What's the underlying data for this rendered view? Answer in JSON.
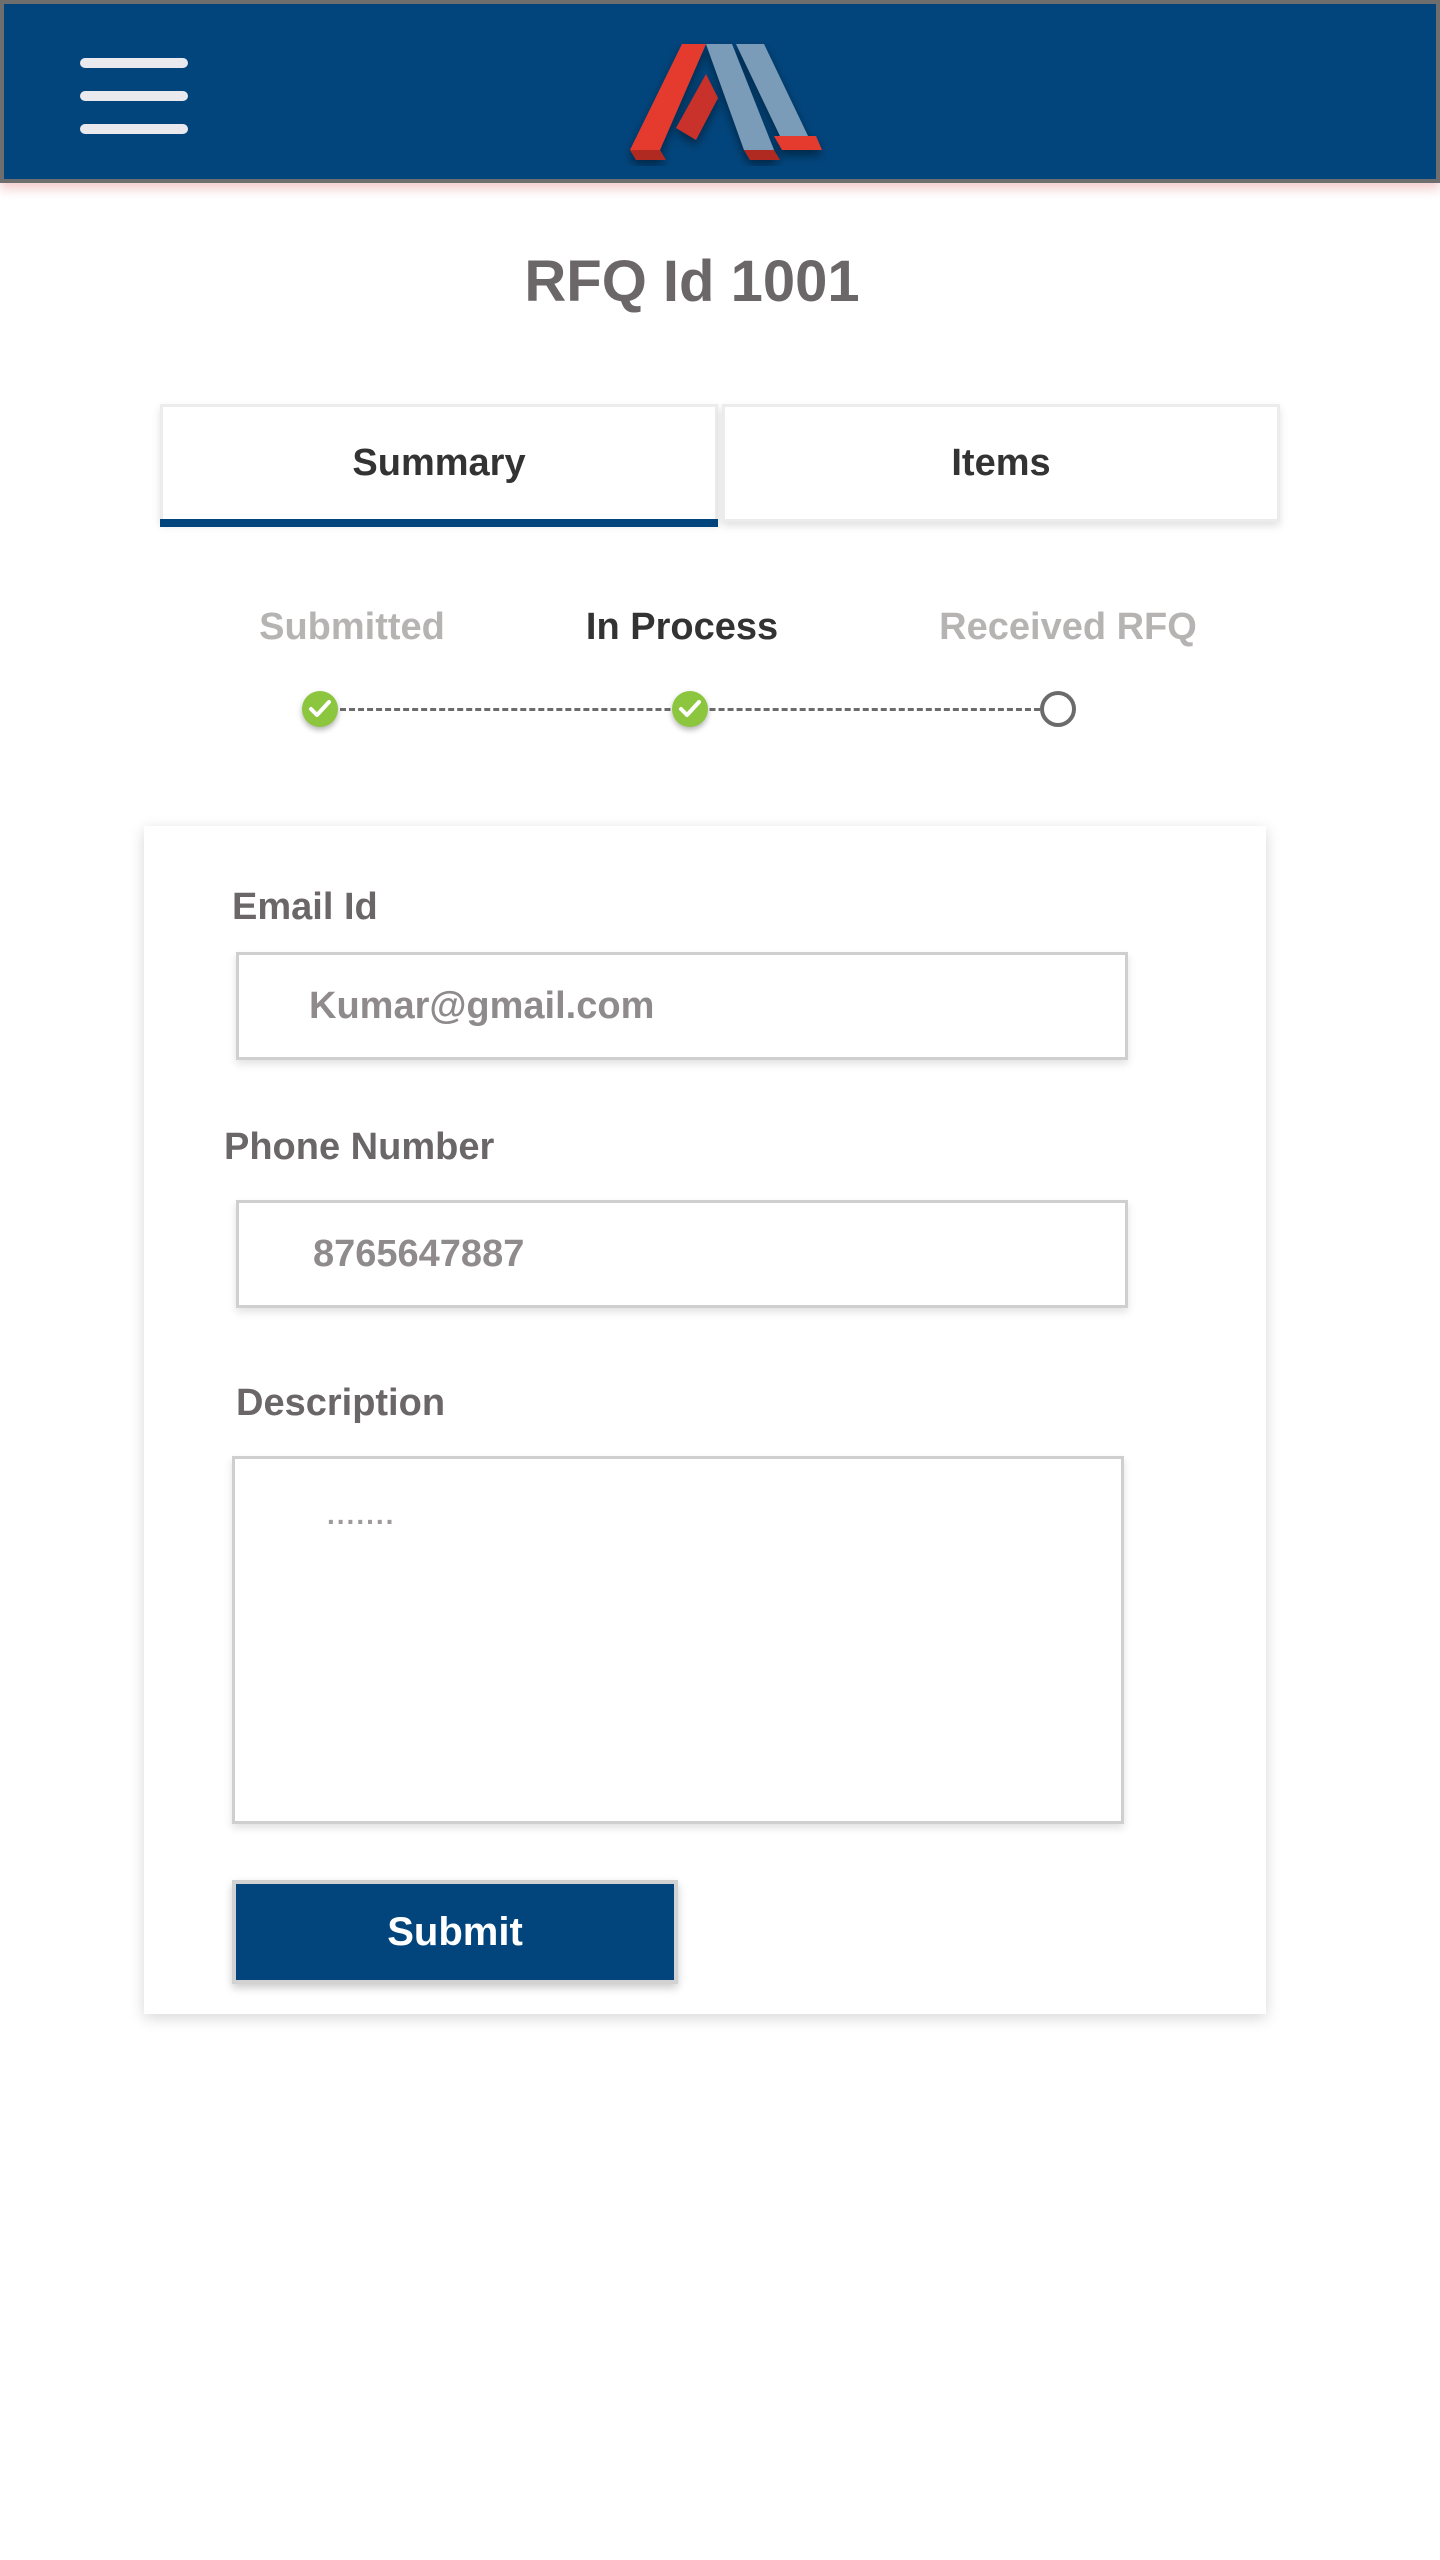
{
  "header": {
    "menu_icon": "hamburger-menu-icon",
    "logo_icon": "brand-logo-icon",
    "brand_colors": {
      "primary": "#02457c",
      "red": "#e53a2f",
      "steel": "#7a9cb8"
    }
  },
  "page": {
    "title": "RFQ Id 1001"
  },
  "tabs": [
    {
      "label": "Summary",
      "active": true
    },
    {
      "label": "Items",
      "active": false
    }
  ],
  "stepper": {
    "steps": [
      {
        "label": "Submitted",
        "status": "done",
        "icon": "check-circle-icon"
      },
      {
        "label": "In Process",
        "status": "current",
        "icon": "check-circle-icon"
      },
      {
        "label": "Received RFQ",
        "status": "pending",
        "icon": "empty-circle-icon"
      }
    ],
    "colors": {
      "done": "#8cc63f",
      "pending": "#6b6b6b"
    }
  },
  "form": {
    "email": {
      "label": "Email Id",
      "value": "Kumar@gmail.com"
    },
    "phone": {
      "label": "Phone Number",
      "value": "8765647887"
    },
    "description": {
      "label": "Description",
      "placeholder": "......."
    },
    "submit_label": "Submit"
  }
}
